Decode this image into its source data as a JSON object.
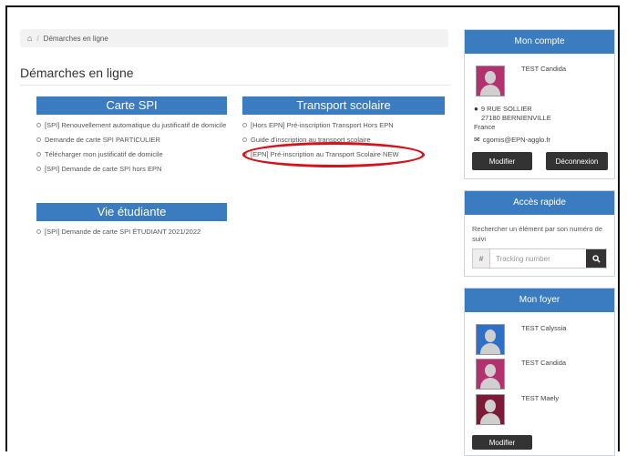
{
  "breadcrumb": {
    "home_icon": "home-icon",
    "separator": "/",
    "current": "Démarches en ligne"
  },
  "page_title": "Démarches en ligne",
  "categories": {
    "carte_spi": {
      "title": "Carte SPI",
      "items": [
        "[SPI] Renouvellement automatique du justificatif de domicile",
        "Demande de carte SPI PARTICULIER",
        "Télécharger mon justificatif de domicile",
        "[SPI] Demande de carte SPI hors EPN"
      ]
    },
    "transport": {
      "title": "Transport scolaire",
      "items": [
        "[Hors EPN] Pré-inscription Transport Hors EPN",
        "Guide d'inscription au transport scolaire",
        "[EPN] Pré-inscription au Transport Scolaire NEW"
      ]
    },
    "vie_etudiante": {
      "title": "Vie étudiante",
      "items": [
        "[SPI] Demande de carte SPI ÉTUDIANT 2021/2022"
      ]
    }
  },
  "account": {
    "title": "Mon compte",
    "name": "TEST Candida",
    "address_line1": "9 RUE SOLLIER",
    "address_line2": "27180 BERNIENVILLE",
    "address_line3": "France",
    "email": "cgomis@EPN-agglo.fr",
    "modify_label": "Modifier",
    "logout_label": "Déconnexion"
  },
  "quick_access": {
    "title": "Accès rapide",
    "help": "Rechercher un élément par son numéro de suivi",
    "prefix": "#",
    "placeholder": "Tracking number"
  },
  "household": {
    "title": "Mon foyer",
    "members": [
      "TEST Calyssia",
      "TEST Candida",
      "TEST Maely"
    ],
    "modify_label": "Modifier"
  },
  "colors": {
    "accent": "#3a7cbf",
    "dark_button": "#333333",
    "highlight": "#d4131b"
  }
}
